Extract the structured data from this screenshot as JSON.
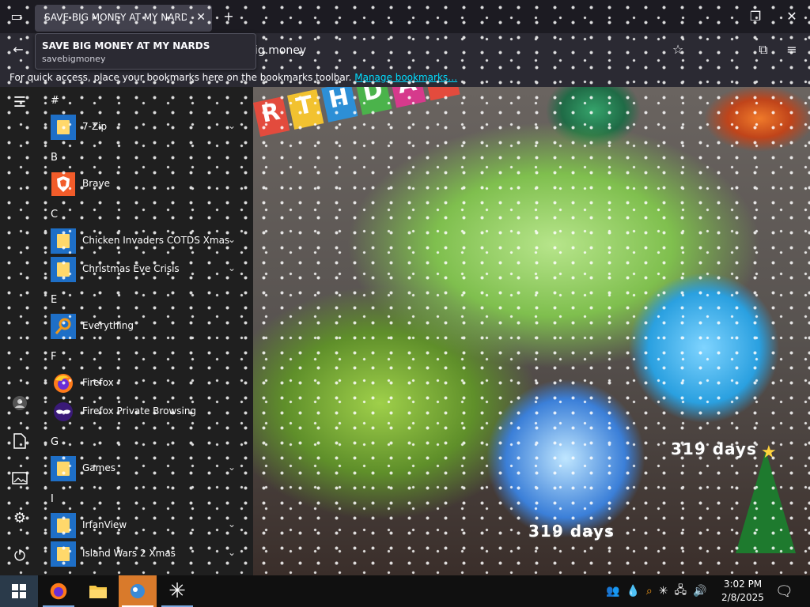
{
  "browser": {
    "tab_title": "SAVE BIG MONEY AT MY NARDS",
    "tooltip_title": "SAVE BIG MONEY AT MY NARDS",
    "tooltip_url": "savebigmoney",
    "url_fragment": "ig.money",
    "bookmarks_text": "For quick access, place your bookmarks here on the bookmarks toolbar.",
    "bookmarks_link": "Manage bookmarks…",
    "new_tab_symbol": "+",
    "close_symbol": "✕"
  },
  "wallpaper": {
    "banner_letters": [
      "R",
      "T",
      "H",
      "D",
      "A",
      "Y"
    ],
    "globe_left_days": "319 days",
    "globe_right_days": "319 days"
  },
  "start_menu": {
    "sections": [
      {
        "letter": "#",
        "apps": [
          {
            "label": "7-Zip",
            "icon": "folder-icon",
            "expandable": true
          }
        ]
      },
      {
        "letter": "B",
        "apps": [
          {
            "label": "Brave",
            "icon": "brave-icon",
            "expandable": false
          }
        ]
      },
      {
        "letter": "C",
        "apps": [
          {
            "label": "Chicken Invaders COTDS Xmas",
            "icon": "folder-icon",
            "expandable": true
          },
          {
            "label": "Christmas Eve Crisis",
            "icon": "folder-icon",
            "expandable": true
          }
        ]
      },
      {
        "letter": "E",
        "apps": [
          {
            "label": "Everything",
            "icon": "everything-icon",
            "expandable": false
          }
        ]
      },
      {
        "letter": "F",
        "apps": [
          {
            "label": "Firefox",
            "icon": "firefox-icon",
            "expandable": false
          },
          {
            "label": "Firefox Private Browsing",
            "icon": "firefox-private-icon",
            "expandable": false
          }
        ]
      },
      {
        "letter": "G",
        "apps": [
          {
            "label": "Games",
            "icon": "folder-icon",
            "expandable": true
          }
        ]
      },
      {
        "letter": "I",
        "apps": [
          {
            "label": "IrfanView",
            "icon": "folder-icon",
            "expandable": true
          },
          {
            "label": "Island Wars 2 Xmas",
            "icon": "folder-icon",
            "expandable": true
          }
        ]
      }
    ]
  },
  "taskbar": {
    "clock_time": "3:02 PM",
    "clock_date": "2/8/2025"
  },
  "colors": {
    "accent_link": "#00ddff",
    "active_task": "#d97a2b"
  }
}
